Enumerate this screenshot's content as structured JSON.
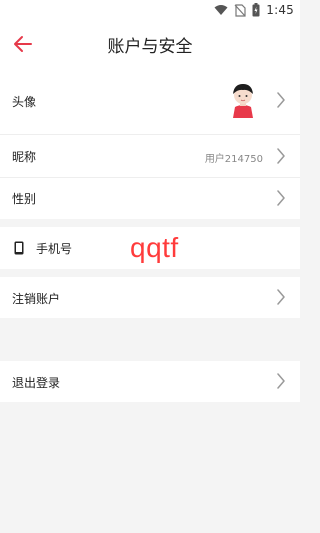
{
  "status_bar": {
    "time": "1:45",
    "icons": [
      "wifi-icon",
      "no-sim-icon",
      "battery-icon"
    ]
  },
  "header": {
    "title": "账户与安全",
    "back_icon": "arrow-left-icon",
    "accent": "#e6394a"
  },
  "rows": {
    "avatar": {
      "label": "头像"
    },
    "nickname": {
      "label": "昵称",
      "value": "用户214750"
    },
    "gender": {
      "label": "性别"
    },
    "phone": {
      "label": "手机号",
      "icon": "phone-icon"
    },
    "cancel_account": {
      "label": "注销账户"
    },
    "logout": {
      "label": "退出登录"
    }
  },
  "watermark": {
    "text": "qqtf",
    "color": "#ff3b3b"
  }
}
